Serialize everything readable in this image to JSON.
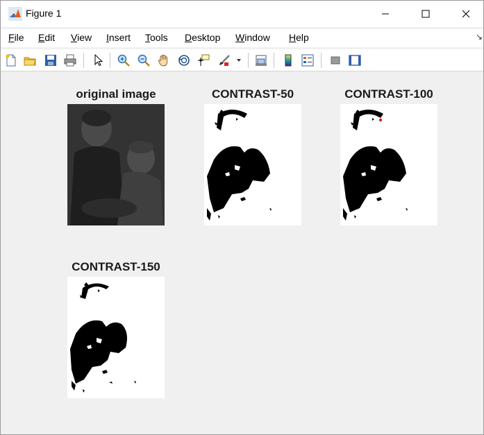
{
  "window": {
    "title": "Figure 1",
    "dock_arrow": "↘"
  },
  "menu": {
    "items": [
      {
        "acc": "F",
        "rest": "ile"
      },
      {
        "acc": "E",
        "rest": "dit"
      },
      {
        "acc": "V",
        "rest": "iew"
      },
      {
        "acc": "I",
        "rest": "nsert"
      },
      {
        "acc": "T",
        "rest": "ools"
      },
      {
        "acc": "D",
        "rest": "esktop"
      },
      {
        "acc": "W",
        "rest": "indow"
      },
      {
        "acc": "H",
        "rest": "elp"
      }
    ]
  },
  "toolbar": {
    "icons": [
      "new-file-icon",
      "open-folder-icon",
      "save-icon",
      "print-icon",
      "pointer-icon",
      "zoom-in-icon",
      "zoom-out-icon",
      "pan-hand-icon",
      "rotate-3d-icon",
      "data-cursor-icon",
      "brush-icon",
      "brush-dropdown-icon",
      "link-plot-icon",
      "colorbar-icon",
      "legend-icon",
      "hide-plot-tools-icon",
      "show-plot-tools-icon"
    ]
  },
  "plots": [
    {
      "title": "original image",
      "kind": "grayscale-dark"
    },
    {
      "title": "CONTRAST-50",
      "kind": "binary"
    },
    {
      "title": "CONTRAST-100",
      "kind": "binary-marker"
    },
    {
      "title": "CONTRAST-150",
      "kind": "binary"
    }
  ],
  "colors": {
    "titlebar": "#ffffff",
    "figure_bg": "#f0f0f0",
    "marker": "#e02020"
  }
}
